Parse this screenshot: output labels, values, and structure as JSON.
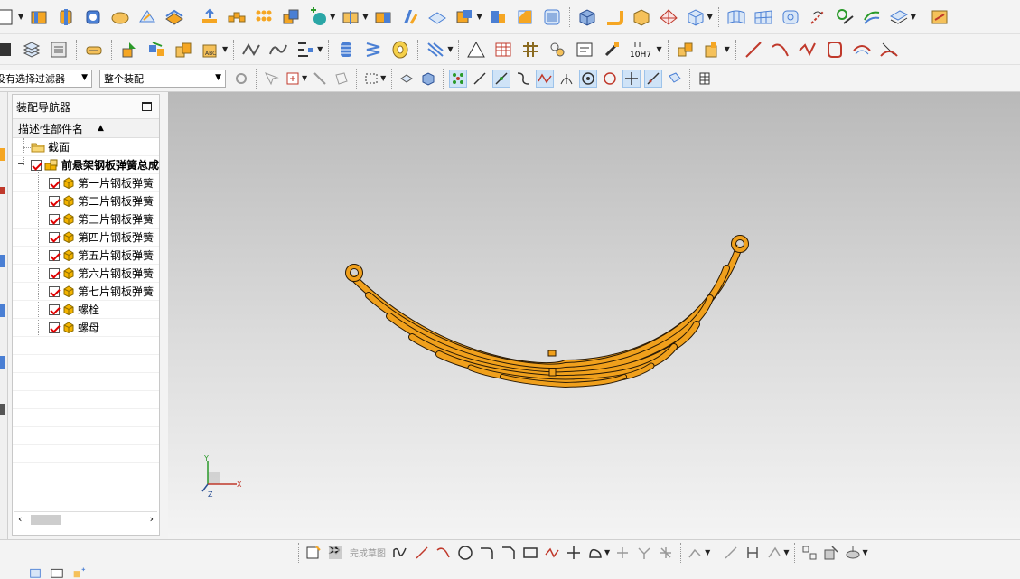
{
  "selection_bar": {
    "filter_value": "没有选择过滤器",
    "scope_value": "整个装配"
  },
  "toolbar": {
    "dimension_label": "10H7",
    "finish_sketch_label": "完成草图"
  },
  "navigator": {
    "title": "装配导航器",
    "column_header": "描述性部件名",
    "section_node": "截面",
    "root_node": "前悬架钢板弹簧总成",
    "children": [
      "第一片钢板弹簧",
      "第二片钢板弹簧",
      "第三片钢板弹簧",
      "第四片钢板弹簧",
      "第五片钢板弹簧",
      "第六片钢板弹簧",
      "第七片钢板弹簧",
      "螺栓",
      "螺母"
    ]
  },
  "triad": {
    "x_label": "X",
    "y_label": "Y",
    "z_label": "Z"
  },
  "colors": {
    "spring_orange": "#f0a01c",
    "spring_edge": "#2a1a05",
    "check_red": "#e00000",
    "part_yellow": "#f4b400"
  },
  "icons": [
    "new-file-icon",
    "block-icon",
    "cylinder-icon",
    "extrude-icon",
    "revolve-icon",
    "sweep-icon",
    "layer-icon",
    "assembly-icon",
    "sketch-icon",
    "hole-icon",
    "spring-icon",
    "thread-icon",
    "measure-icon",
    "snap-point-icon",
    "line-icon",
    "arc-icon",
    "circle-icon",
    "rectangle-icon",
    "point-icon"
  ]
}
